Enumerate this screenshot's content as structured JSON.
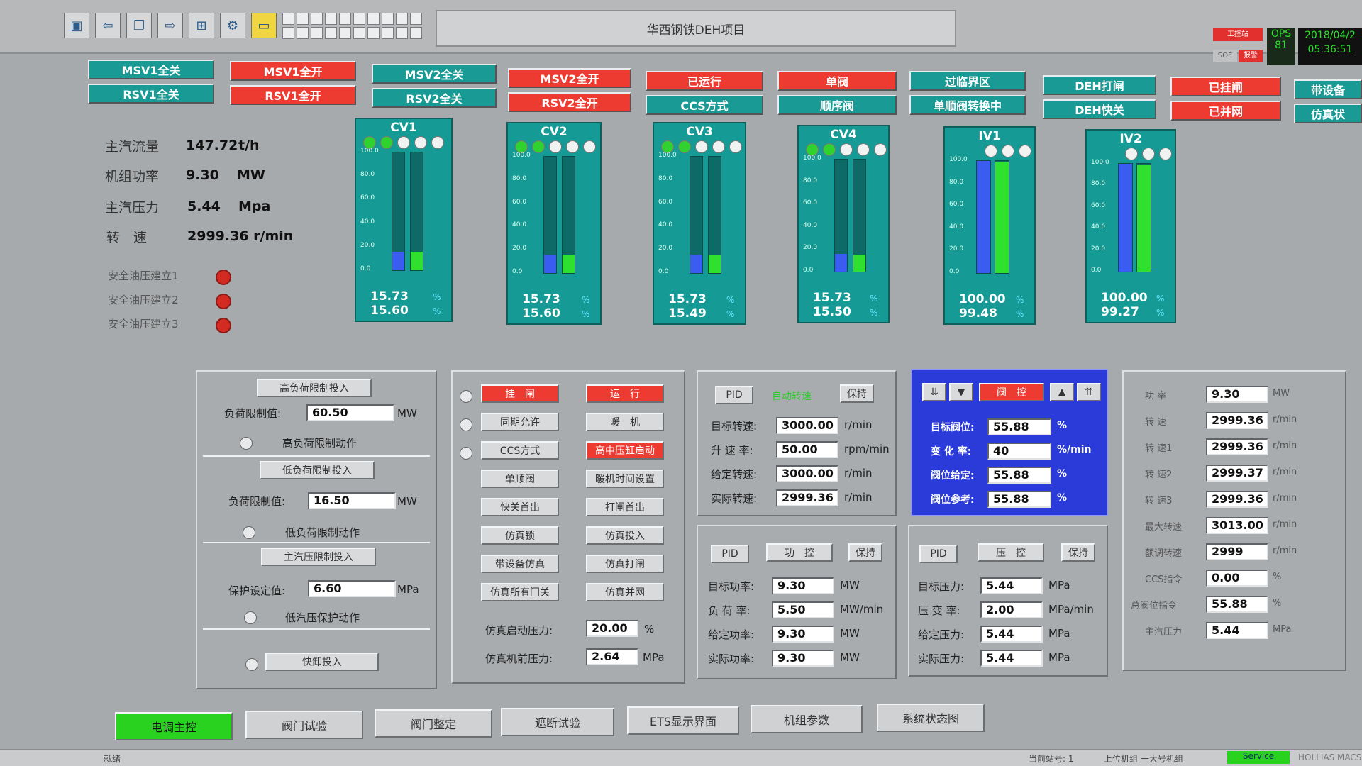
{
  "toolbar": {
    "icons": [
      "monitor-icon",
      "arrow-left-icon",
      "copy-icon",
      "arrow-right-icon",
      "network-icon",
      "tools-icon",
      "folder-icon"
    ],
    "title": "华西钢铁DEH项目",
    "badge_top": "工控站",
    "badge_soe": "SOE",
    "badge_alarm": "报警",
    "ops_label": "OPS",
    "ops_num": "81",
    "date": "2018/04/2",
    "time": "05:36:51"
  },
  "status_buttons": [
    {
      "label": "MSV1全关",
      "color": "teal"
    },
    {
      "label": "RSV1全关",
      "color": "teal"
    },
    {
      "label": "MSV1全开",
      "color": "red"
    },
    {
      "label": "RSV1全开",
      "color": "red"
    },
    {
      "label": "MSV2全关",
      "color": "teal"
    },
    {
      "label": "RSV2全关",
      "color": "teal"
    },
    {
      "label": "MSV2全开",
      "color": "red"
    },
    {
      "label": "RSV2全开",
      "color": "red"
    },
    {
      "label": "已运行",
      "color": "red"
    },
    {
      "label": "CCS方式",
      "color": "teal"
    },
    {
      "label": "单阀",
      "color": "red"
    },
    {
      "label": "顺序阀",
      "color": "teal"
    },
    {
      "label": "过临界区",
      "color": "teal"
    },
    {
      "label": "单顺阀转换中",
      "color": "teal"
    },
    {
      "label": "DEH打闸",
      "color": "teal"
    },
    {
      "label": "DEH快关",
      "color": "teal"
    },
    {
      "label": "已挂闸",
      "color": "red"
    },
    {
      "label": "已并网",
      "color": "red"
    },
    {
      "label": "带设备",
      "color": "teal"
    },
    {
      "label": "仿真状",
      "color": "teal"
    }
  ],
  "main_info": {
    "steam_flow_label": "主汽流量",
    "steam_flow_value": "147.72",
    "steam_flow_unit": "t/h",
    "unit_power_label": "机组功率",
    "unit_power_value": "9.30",
    "unit_power_unit": "MW",
    "steam_pressure_label": "主汽压力",
    "steam_pressure_value": "5.44",
    "steam_pressure_unit": "Mpa",
    "speed_label": "转　速",
    "speed_value": "2999.36 r/min"
  },
  "oil": [
    "安全油压建立1",
    "安全油压建立2",
    "安全油压建立3"
  ],
  "gauges": [
    {
      "name": "CV1",
      "cmd": "15.73",
      "fb": "15.60",
      "cmd_frac": 0.157,
      "fb_frac": 0.156,
      "dots": [
        "g",
        "g",
        "w",
        "w",
        "w"
      ]
    },
    {
      "name": "CV2",
      "cmd": "15.73",
      "fb": "15.60",
      "cmd_frac": 0.157,
      "fb_frac": 0.156,
      "dots": [
        "g",
        "g",
        "w",
        "w",
        "w"
      ]
    },
    {
      "name": "CV3",
      "cmd": "15.73",
      "fb": "15.49",
      "cmd_frac": 0.157,
      "fb_frac": 0.155,
      "dots": [
        "g",
        "g",
        "w",
        "w",
        "w"
      ]
    },
    {
      "name": "CV4",
      "cmd": "15.73",
      "fb": "15.50",
      "cmd_frac": 0.157,
      "fb_frac": 0.155,
      "dots": [
        "g",
        "g",
        "w",
        "w",
        "w"
      ]
    },
    {
      "name": "IV1",
      "cmd": "100.00",
      "fb": "99.48",
      "cmd_frac": 1.0,
      "fb_frac": 0.995,
      "dots": [
        "w",
        "w",
        "w"
      ]
    },
    {
      "name": "IV2",
      "cmd": "100.00",
      "fb": "99.27",
      "cmd_frac": 1.0,
      "fb_frac": 0.993,
      "dots": [
        "w",
        "w",
        "w"
      ]
    }
  ],
  "gauge_scale": [
    "100.0",
    "80.0",
    "60.0",
    "40.0",
    "20.0",
    "0.0"
  ],
  "pct": "%",
  "limits": {
    "high_btn": "高负荷限制投入",
    "high_label": "负荷限制值:",
    "high_value": "60.50",
    "high_unit": "MW",
    "high_action": "高负荷限制动作",
    "low_btn": "低负荷限制投入",
    "low_label": "负荷限制值:",
    "low_value": "16.50",
    "low_unit": "MW",
    "low_action": "低负荷限制动作",
    "press_btn": "主汽压限制投入",
    "press_label": "保护设定值:",
    "press_value": "6.60",
    "press_unit": "MPa",
    "press_action": "低汽压保护动作",
    "fast_btn": "快卸投入"
  },
  "ops": {
    "trip": "挂　闸",
    "run": "运　行",
    "sync": "同期允许",
    "warm": "暖　机",
    "ccs": "CCS方式",
    "hp_start": "高中压缸启动",
    "single_valve": "单顺阀",
    "warm_time": "暖机时间设置",
    "fast_close": "快关首出",
    "trip_first": "打闸首出",
    "sim_lock": "仿真锁",
    "sim_in": "仿真投入",
    "dev_sim": "带设备仿真",
    "sim_trip": "仿真打闸",
    "sim_all_close": "仿真所有门关",
    "sim_grid": "仿真并网",
    "sim_start_p_label": "仿真启动压力:",
    "sim_start_p_value": "20.00",
    "sim_start_p_unit": "%",
    "sim_front_p_label": "仿真机前压力:",
    "sim_front_p_value": "2.64",
    "sim_front_p_unit": "MPa"
  },
  "speed_ctrl": {
    "pid": "PID",
    "status": "自动转速",
    "hold": "保持",
    "rows": [
      {
        "label": "目标转速:",
        "value": "3000.00",
        "unit": "r/min"
      },
      {
        "label": "升 速 率:",
        "value": "50.00",
        "unit": "rpm/min"
      },
      {
        "label": "给定转速:",
        "value": "3000.00",
        "unit": "r/min"
      },
      {
        "label": "实际转速:",
        "value": "2999.36",
        "unit": "r/min"
      }
    ]
  },
  "valve_ctrl": {
    "mode": "阀　控",
    "rows": [
      {
        "label": "目标阀位:",
        "value": "55.88",
        "unit": "%"
      },
      {
        "label": "变 化 率:",
        "value": "40",
        "unit": "%/min"
      },
      {
        "label": "阀位给定:",
        "value": "55.88",
        "unit": "%"
      },
      {
        "label": "阀位参考:",
        "value": "55.88",
        "unit": "%"
      }
    ]
  },
  "power_ctrl": {
    "pid": "PID",
    "mode": "功　控",
    "hold": "保持",
    "rows": [
      {
        "label": "目标功率:",
        "value": "9.30",
        "unit": "MW"
      },
      {
        "label": "负 荷 率:",
        "value": "5.50",
        "unit": "MW/min"
      },
      {
        "label": "给定功率:",
        "value": "9.30",
        "unit": "MW"
      },
      {
        "label": "实际功率:",
        "value": "9.30",
        "unit": "MW"
      }
    ]
  },
  "press_ctrl": {
    "pid": "PID",
    "mode": "压　控",
    "hold": "保持",
    "rows": [
      {
        "label": "目标压力:",
        "value": "5.44",
        "unit": "MPa"
      },
      {
        "label": "压 变 率:",
        "value": "2.00",
        "unit": "MPa/min"
      },
      {
        "label": "给定压力:",
        "value": "5.44",
        "unit": "MPa"
      },
      {
        "label": "实际压力:",
        "value": "5.44",
        "unit": "MPa"
      }
    ]
  },
  "right_panel": [
    {
      "label": "功 率",
      "value": "9.30",
      "unit": "MW"
    },
    {
      "label": "转 速",
      "value": "2999.36",
      "unit": "r/min"
    },
    {
      "label": "转 速1",
      "value": "2999.36",
      "unit": "r/min"
    },
    {
      "label": "转 速2",
      "value": "2999.37",
      "unit": "r/min"
    },
    {
      "label": "转 速3",
      "value": "2999.36",
      "unit": "r/min"
    },
    {
      "label": "最大转速",
      "value": "3013.00",
      "unit": "r/min"
    },
    {
      "label": "额调转速",
      "value": "2999",
      "unit": "r/min"
    },
    {
      "label": "CCS指令",
      "value": "0.00",
      "unit": "%"
    },
    {
      "label": "总阀位指令",
      "value": "55.88",
      "unit": "%"
    },
    {
      "label": "主汽压力",
      "value": "5.44",
      "unit": "MPa"
    }
  ],
  "nav": [
    "电调主控",
    "阀门试验",
    "阀门整定",
    "遮断试验",
    "ETS显示界面",
    "机组参数",
    "系统状态图"
  ],
  "statusbar": {
    "ready": "就绪",
    "current_station": "当前站号: 1",
    "domain": "上位机组 一大号机组",
    "badge": "Service",
    "brand": "HOLLIAS MACS"
  },
  "colors": {
    "teal": "#1a9a94",
    "red": "#ee3b32",
    "blue_panel": "#2a3bd9",
    "green": "#28d21f",
    "bar_blue": "#3a5cf0",
    "bar_green": "#2fe02f"
  }
}
